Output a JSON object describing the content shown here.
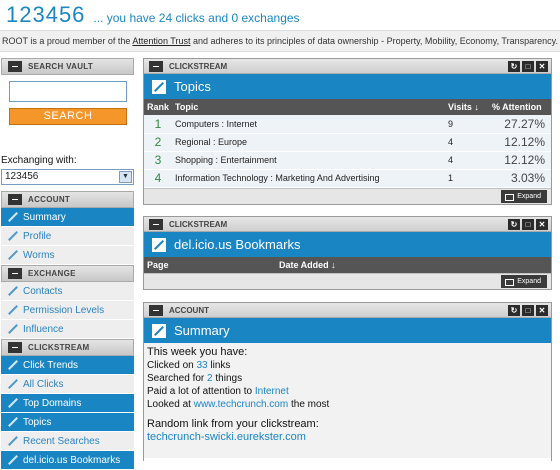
{
  "header": {
    "site_id": "123456",
    "subtitle": "... you have 24 clicks and 0 exchanges"
  },
  "member_bar": {
    "pre": "ROOT is a proud member of the ",
    "link": "Attention Trust",
    "post": " and adheres to its principles of data ownership - Property, Mobility, Economy, Transparency."
  },
  "sidebar": {
    "vault": {
      "title": "SEARCH VAULT",
      "search_value": "",
      "button": "SEARCH",
      "exch_label": "Exchanging with:",
      "exch_value": "123456"
    },
    "account": {
      "title": "ACCOUNT",
      "items": [
        {
          "label": "Summary"
        },
        {
          "label": "Profile"
        },
        {
          "label": "Worms"
        }
      ]
    },
    "exchange": {
      "title": "EXCHANGE",
      "items": [
        {
          "label": "Contacts"
        },
        {
          "label": "Permission Levels"
        },
        {
          "label": "Influence"
        }
      ]
    },
    "clickstream": {
      "title": "CLICKSTREAM",
      "items": [
        {
          "label": "Click Trends"
        },
        {
          "label": "All Clicks"
        },
        {
          "label": "Top Domains"
        },
        {
          "label": "Topics"
        },
        {
          "label": "Recent Searches"
        },
        {
          "label": "del.icio.us Bookmarks"
        }
      ]
    }
  },
  "topics_panel": {
    "head": "CLICKSTREAM",
    "title": "Topics",
    "columns": {
      "rank": "Rank",
      "topic": "Topic",
      "visits": "Visits ↓",
      "attention": "% Attention"
    },
    "rows": [
      {
        "rank": "1",
        "topic": "Computers : Internet",
        "visits": "9",
        "attention": "27.27%"
      },
      {
        "rank": "2",
        "topic": "Regional : Europe",
        "visits": "4",
        "attention": "12.12%"
      },
      {
        "rank": "3",
        "topic": "Shopping : Entertainment",
        "visits": "4",
        "attention": "12.12%"
      },
      {
        "rank": "4",
        "topic": "Information Technology : Marketing And Advertising",
        "visits": "1",
        "attention": "3.03%"
      }
    ],
    "expand": "Expand"
  },
  "delicious_panel": {
    "head": "CLICKSTREAM",
    "title": "del.icio.us Bookmarks",
    "columns": {
      "page": "Page",
      "date": "Date Added ↓"
    },
    "expand": "Expand"
  },
  "summary_panel": {
    "head": "ACCOUNT",
    "title": "Summary",
    "intro": "This week you have:",
    "l1_pre": "Clicked on ",
    "l1_val": "33",
    "l1_post": " links",
    "l2_pre": "Searched for ",
    "l2_val": "2",
    "l2_post": " things",
    "l3_pre": "Paid a lot of attention to ",
    "l3_val": "Internet",
    "l4_pre": "Looked at ",
    "l4_val": "www.techcrunch.com",
    "l4_post": " the most",
    "random_label": "Random link from your clickstream:",
    "random_link": "techcrunch-swicki.eurekster.com"
  },
  "colors": {
    "accent": "#1a85c3",
    "button": "#f4962a",
    "rank": "#2e8b3e"
  },
  "icons": {
    "minimize": "minimize-icon",
    "refresh": "refresh-icon",
    "maximize": "maximize-icon",
    "close": "close-icon",
    "edit": "pencil-icon"
  }
}
